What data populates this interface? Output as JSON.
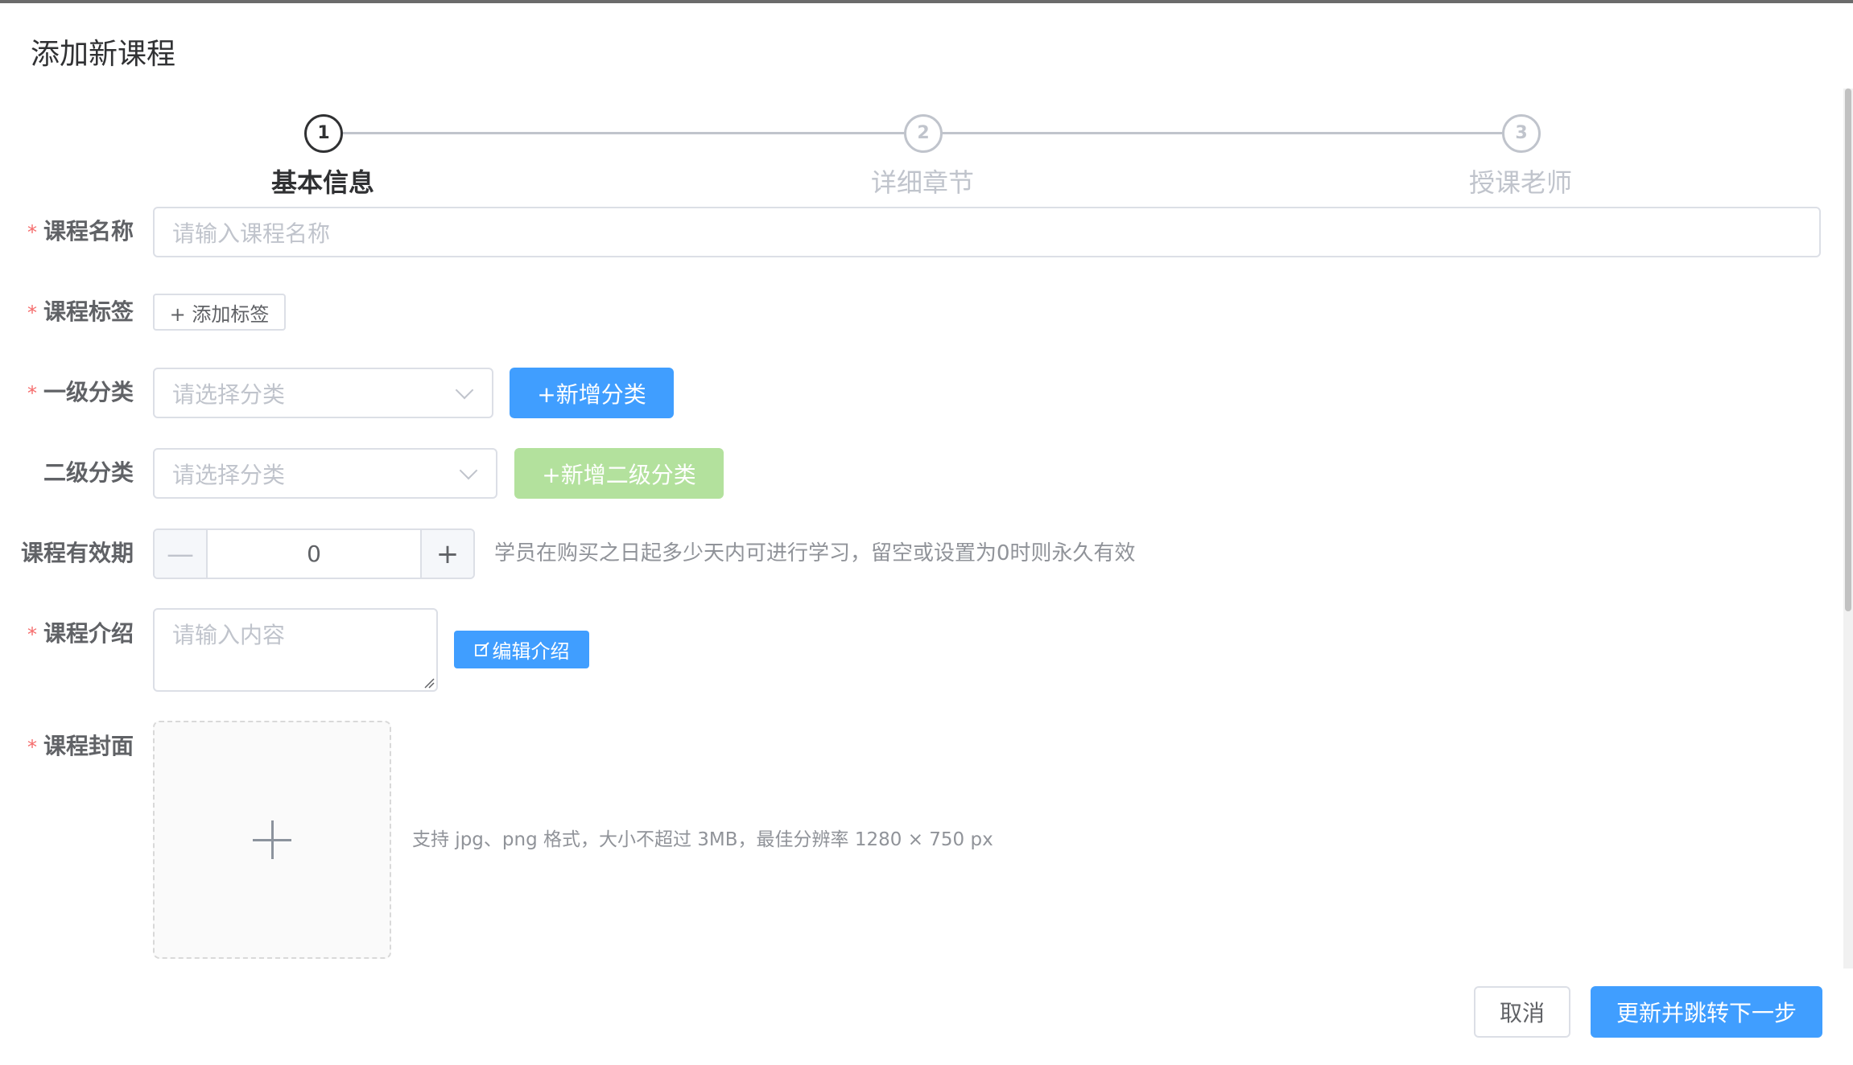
{
  "dialog": {
    "title": "添加新课程"
  },
  "steps": [
    {
      "number": "1",
      "title": "基本信息"
    },
    {
      "number": "2",
      "title": "详细章节"
    },
    {
      "number": "3",
      "title": "授课老师"
    }
  ],
  "form": {
    "required_mark": "*",
    "course_name": {
      "label": "课程名称",
      "placeholder": "请输入课程名称"
    },
    "course_tags": {
      "label": "课程标签",
      "add_button": "+ 添加标签"
    },
    "primary_category": {
      "label": "一级分类",
      "placeholder": "请选择分类",
      "add_button": "+新增分类"
    },
    "secondary_category": {
      "label": "二级分类",
      "placeholder": "请选择分类",
      "add_button": "+新增二级分类"
    },
    "validity": {
      "label": "课程有效期",
      "value": "0",
      "minus": "—",
      "plus": "+",
      "hint": "学员在购买之日起多少天内可进行学习，留空或设置为0时则永久有效"
    },
    "intro": {
      "label": "课程介绍",
      "placeholder": "请输入内容",
      "edit_button": "编辑介绍"
    },
    "cover": {
      "label": "课程封面",
      "hint": "支持 jpg、png 格式，大小不超过 3MB，最佳分辨率 1280 × 750 px"
    }
  },
  "footer": {
    "cancel": "取消",
    "submit": "更新并跳转下一步"
  },
  "colors": {
    "primary": "#409eff",
    "success_disabled": "#b3e19d",
    "required": "#f56c6c"
  },
  "icons": {
    "edit": "edit-icon",
    "plus": "plus-icon",
    "chevron": "chevron-down-icon"
  }
}
